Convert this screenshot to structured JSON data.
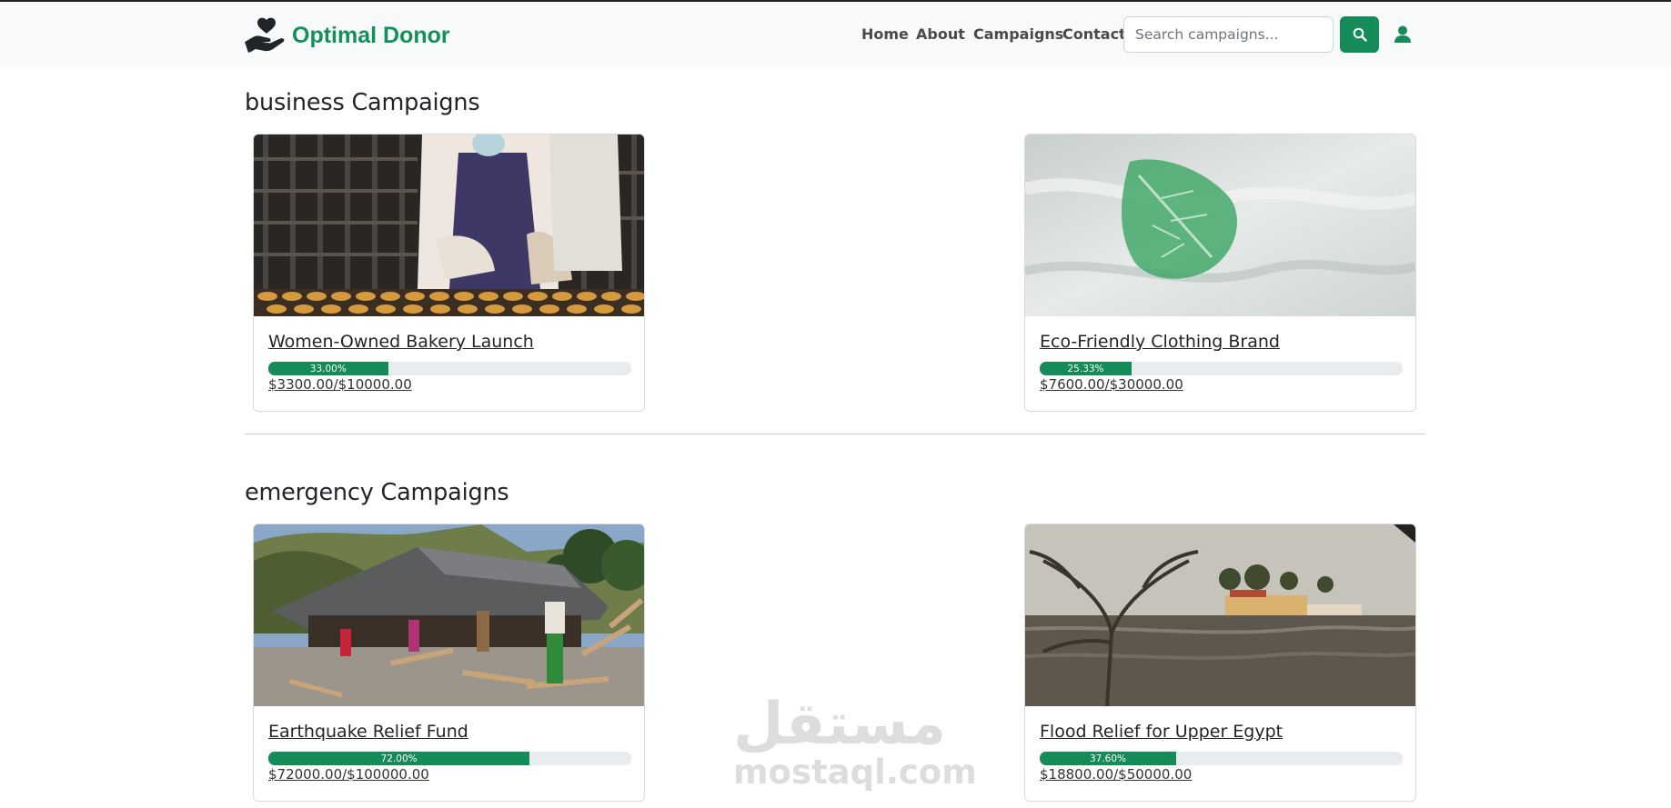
{
  "brand": {
    "name": "Optimal Donor",
    "icon": "heart-hand-icon",
    "color": "#14905a"
  },
  "nav": {
    "links": [
      {
        "label": "Home"
      },
      {
        "label": "About"
      },
      {
        "label": "Campaigns"
      },
      {
        "label": "Contact"
      }
    ],
    "search_placeholder": "Search campaigns...",
    "search_icon": "search-icon",
    "user_icon": "user-icon",
    "accent": "#148b59"
  },
  "sections": [
    {
      "title": "business Campaigns",
      "campaigns": [
        {
          "title": "Women-Owned Bakery Launch",
          "progress_label": "33.00%",
          "progress": 33.0,
          "amount": "$3300.00/$10000.00",
          "image": "bakery-photo"
        },
        {
          "title": "Eco-Friendly Clothing Brand",
          "progress_label": "25.33%",
          "progress": 25.33,
          "amount": "$7600.00/$30000.00",
          "image": "leaf-fabric-photo"
        }
      ]
    },
    {
      "title": "emergency Campaigns",
      "campaigns": [
        {
          "title": "Earthquake Relief Fund",
          "progress_label": "72.00%",
          "progress": 72.0,
          "amount": "$72000.00/$100000.00",
          "image": "earthquake-debris-photo"
        },
        {
          "title": "Flood Relief for Upper Egypt",
          "progress_label": "37.60%",
          "progress": 37.6,
          "amount": "$18800.00/$50000.00",
          "image": "flood-photo"
        }
      ]
    }
  ],
  "watermark": {
    "arabic": "مستقل",
    "latin": "mostaql.com"
  }
}
